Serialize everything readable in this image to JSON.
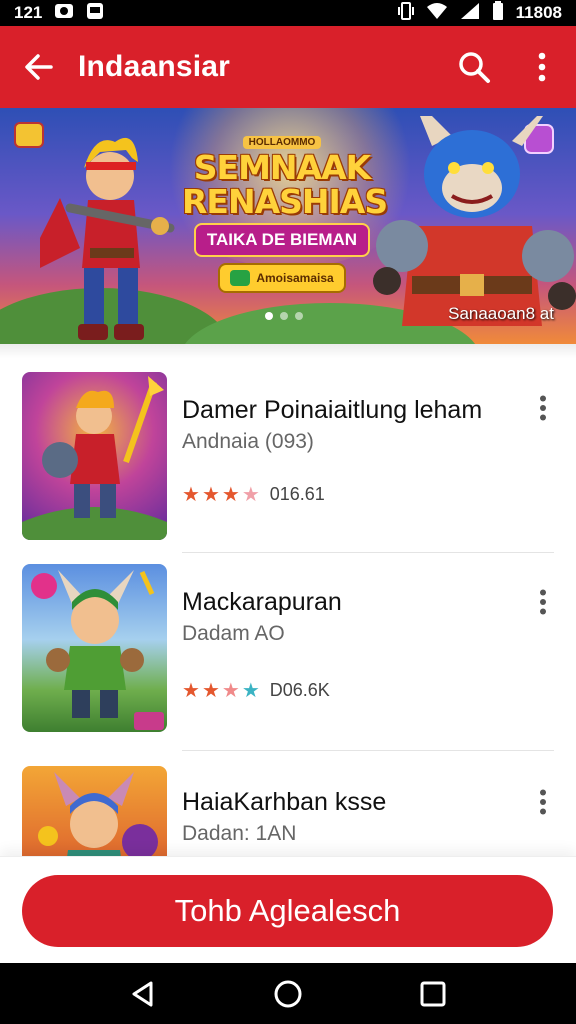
{
  "status_bar": {
    "time": "121",
    "battery_text": "11808"
  },
  "app_bar": {
    "title": "Indaansiar"
  },
  "banner": {
    "mini_tag": "HOLLAOMMO",
    "headline_line1": "SEMNAAK",
    "headline_line2": "RENASHIAS",
    "subtitle": "TAIKA DE BIEMAN",
    "cta_label": "Amoisamaisa",
    "caption": "Sanaaoan8 at",
    "dot_count": 3,
    "active_dot": 0
  },
  "games": [
    {
      "title": "Damer Poinaiaitlung leham",
      "subtitle": "Andnaia (093)",
      "rating": 3.5,
      "rating_text": "016.61",
      "star_color": "#e4572e"
    },
    {
      "title": "Mackarapuran",
      "subtitle": "Dadam AO",
      "rating": 3.5,
      "rating_text": "D06.6K",
      "star_color": "#e4572e"
    },
    {
      "title": "HaiaKarhban ksse",
      "subtitle": "Dadan: 1AN",
      "rating": 0,
      "rating_text": "",
      "star_color": "#e4572e"
    }
  ],
  "primary_button": {
    "label": "Tohb Aglealesch"
  },
  "colors": {
    "brand_red": "#d9202a",
    "star": "#e4572e",
    "star_alt": "#3bb3c3"
  }
}
